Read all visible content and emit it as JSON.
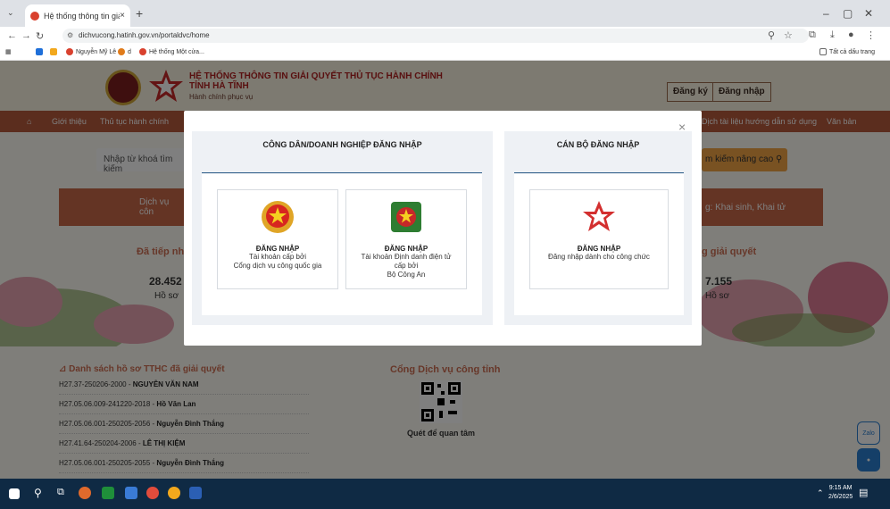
{
  "browser": {
    "tab_title": "Hệ thống thông tin giải quyết",
    "url": "dichvucong.hatinh.gov.vn/portaldvc/home",
    "bookmarks": [
      "Nguyễn Mỹ Lê",
      "d",
      "Hệ thống Một cửa..."
    ],
    "all_bookmarks": "Tất cả dấu trang"
  },
  "header": {
    "title_line1": "HỆ THỐNG THÔNG TIN GIẢI QUYẾT THỦ TỤC HÀNH CHÍNH",
    "title_line2": "TỈNH HÀ TĨNH",
    "subtitle": "Hành chính phục vụ",
    "register": "Đăng ký",
    "login": "Đăng nhập"
  },
  "menu": {
    "items": [
      "Giới thiệu",
      "Thủ tục hành chính"
    ],
    "right_items": [
      "Dịch tài liệu hướng dẫn sử dụng",
      "Văn bản"
    ]
  },
  "search": {
    "placeholder": "Nhập từ khoá tìm kiếm",
    "advanced": "m kiếm nâng cao"
  },
  "services": {
    "left": "Dịch vụ côn",
    "right": "g: Khai sinh, Khai tử"
  },
  "stats": {
    "left_label": "Đã tiếp nhậ",
    "left_value": "28.452",
    "left_unit": "Hồ sơ",
    "right_label": "g giải quyết",
    "right_value": "7.155",
    "right_unit": "Hồ sơ"
  },
  "list": {
    "title": "Danh sách hồ sơ TTHC đã giải quyết",
    "items": [
      {
        "code": "H27.37-250206-2000",
        "name": "NGUYỄN VĂN NAM"
      },
      {
        "code": "H27.05.06.009-241220-2018",
        "name": "Hồ Văn Lan"
      },
      {
        "code": "H27.05.06.001-250205-2056",
        "name": "Nguyễn Đình Thắng"
      },
      {
        "code": "H27.41.64-250204-2006",
        "name": "LÊ THỊ KIỆM"
      },
      {
        "code": "H27.05.06.001-250205-2055",
        "name": "Nguyễn Đình Thắng"
      }
    ]
  },
  "portal": {
    "title": "Cổng Dịch vụ công tỉnh",
    "qr_label": "Quét để quan tâm"
  },
  "side_buttons": {
    "zalo": "Zalo"
  },
  "modal": {
    "close": "×",
    "citizen": {
      "title": "CÔNG DÂN/DOANH NGHIỆP ĐĂNG NHẬP",
      "card1": {
        "title": "ĐĂNG NHẬP",
        "lines": [
          "Tài khoản cấp bởi",
          "Cổng dịch vụ công quốc gia"
        ]
      },
      "card2": {
        "title": "ĐĂNG NHẬP",
        "lines": [
          "Tài khoản Định danh điện tử",
          "cấp bởi",
          "Bộ Công An"
        ]
      }
    },
    "official": {
      "title": "CÁN BỘ ĐĂNG NHẬP",
      "card1": {
        "title": "ĐĂNG NHẬP",
        "lines": [
          "Đăng nhập dành cho công chức"
        ]
      }
    }
  },
  "taskbar": {
    "time": "9:15 AM",
    "date": "2/6/2025"
  },
  "colors": {
    "accent": "#b75a3c",
    "panel_line": "#2f5f8a",
    "title_red": "#b22020"
  }
}
